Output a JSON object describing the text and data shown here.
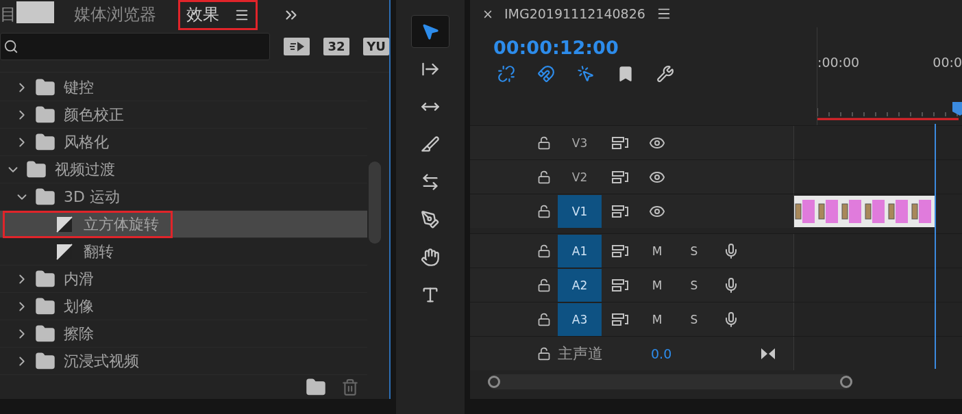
{
  "effects_panel": {
    "tabs": [
      {
        "label": "目",
        "selected": false,
        "covered": true
      },
      {
        "label": "媒体浏览器",
        "selected": false
      },
      {
        "label": "效果",
        "selected": true,
        "highlighted": true
      }
    ],
    "filter_badges": [
      {
        "kind": "accelerated"
      },
      {
        "kind": "text",
        "label": "32"
      },
      {
        "kind": "text",
        "label": "YU"
      }
    ],
    "tree": [
      {
        "children": [
          {
            "kind": "folder",
            "label": "键控",
            "expanded": false,
            "selected": false
          },
          {
            "kind": "folder",
            "label": "颜色校正",
            "expanded": false,
            "selected": false
          },
          {
            "kind": "folder",
            "label": "风格化",
            "expanded": false,
            "selected": false
          }
        ]
      },
      {
        "kind": "folder",
        "label": "视频过渡",
        "expanded": true,
        "selected": false,
        "children": [
          {
            "kind": "folder",
            "label": "3D 运动",
            "expanded": true,
            "selected": false,
            "children": [
              {
                "kind": "effect",
                "label": "立方体旋转",
                "selected": true,
                "highlighted": true
              },
              {
                "kind": "effect",
                "label": "翻转",
                "selected": false
              }
            ]
          },
          {
            "kind": "folder",
            "label": "内滑",
            "expanded": false,
            "selected": false
          },
          {
            "kind": "folder",
            "label": "划像",
            "expanded": false,
            "selected": false
          },
          {
            "kind": "folder",
            "label": "擦除",
            "expanded": false,
            "selected": false
          },
          {
            "kind": "folder",
            "label": "沉浸式视频",
            "expanded": false,
            "selected": false
          }
        ]
      }
    ]
  },
  "tools": [
    {
      "kind": "select",
      "selected": true
    },
    {
      "kind": "track-select",
      "selected": false
    },
    {
      "kind": "ripple",
      "selected": false
    },
    {
      "kind": "razor",
      "selected": false
    },
    {
      "kind": "slip",
      "selected": false
    },
    {
      "kind": "pen",
      "selected": false
    },
    {
      "kind": "hand",
      "selected": false
    },
    {
      "kind": "type",
      "selected": false
    }
  ],
  "timeline": {
    "close": "×",
    "title": "IMG20191112140826",
    "timecode": "00:00:12:00",
    "controls": [
      {
        "kind": "nest",
        "on": true
      },
      {
        "kind": "snap",
        "on": true
      },
      {
        "kind": "linked",
        "on": true
      },
      {
        "kind": "marker",
        "on": false
      },
      {
        "kind": "settings",
        "on": false
      }
    ],
    "ruler_labels": [
      ":00:00",
      "00:0"
    ],
    "tracks": [
      {
        "kind": "video",
        "name": "V3",
        "targeted": false,
        "has_clip": false
      },
      {
        "kind": "video",
        "name": "V2",
        "targeted": false,
        "has_clip": false
      },
      {
        "kind": "video",
        "name": "V1",
        "targeted": true,
        "has_clip": true
      },
      {
        "kind": "audio",
        "name": "A1",
        "targeted": true,
        "mute": "M",
        "solo": "S"
      },
      {
        "kind": "audio",
        "name": "A2",
        "targeted": true,
        "mute": "M",
        "solo": "S"
      },
      {
        "kind": "audio",
        "name": "A3",
        "targeted": true,
        "mute": "M",
        "solo": "S"
      }
    ],
    "master": {
      "label": "主声道",
      "value": "0.0"
    }
  }
}
